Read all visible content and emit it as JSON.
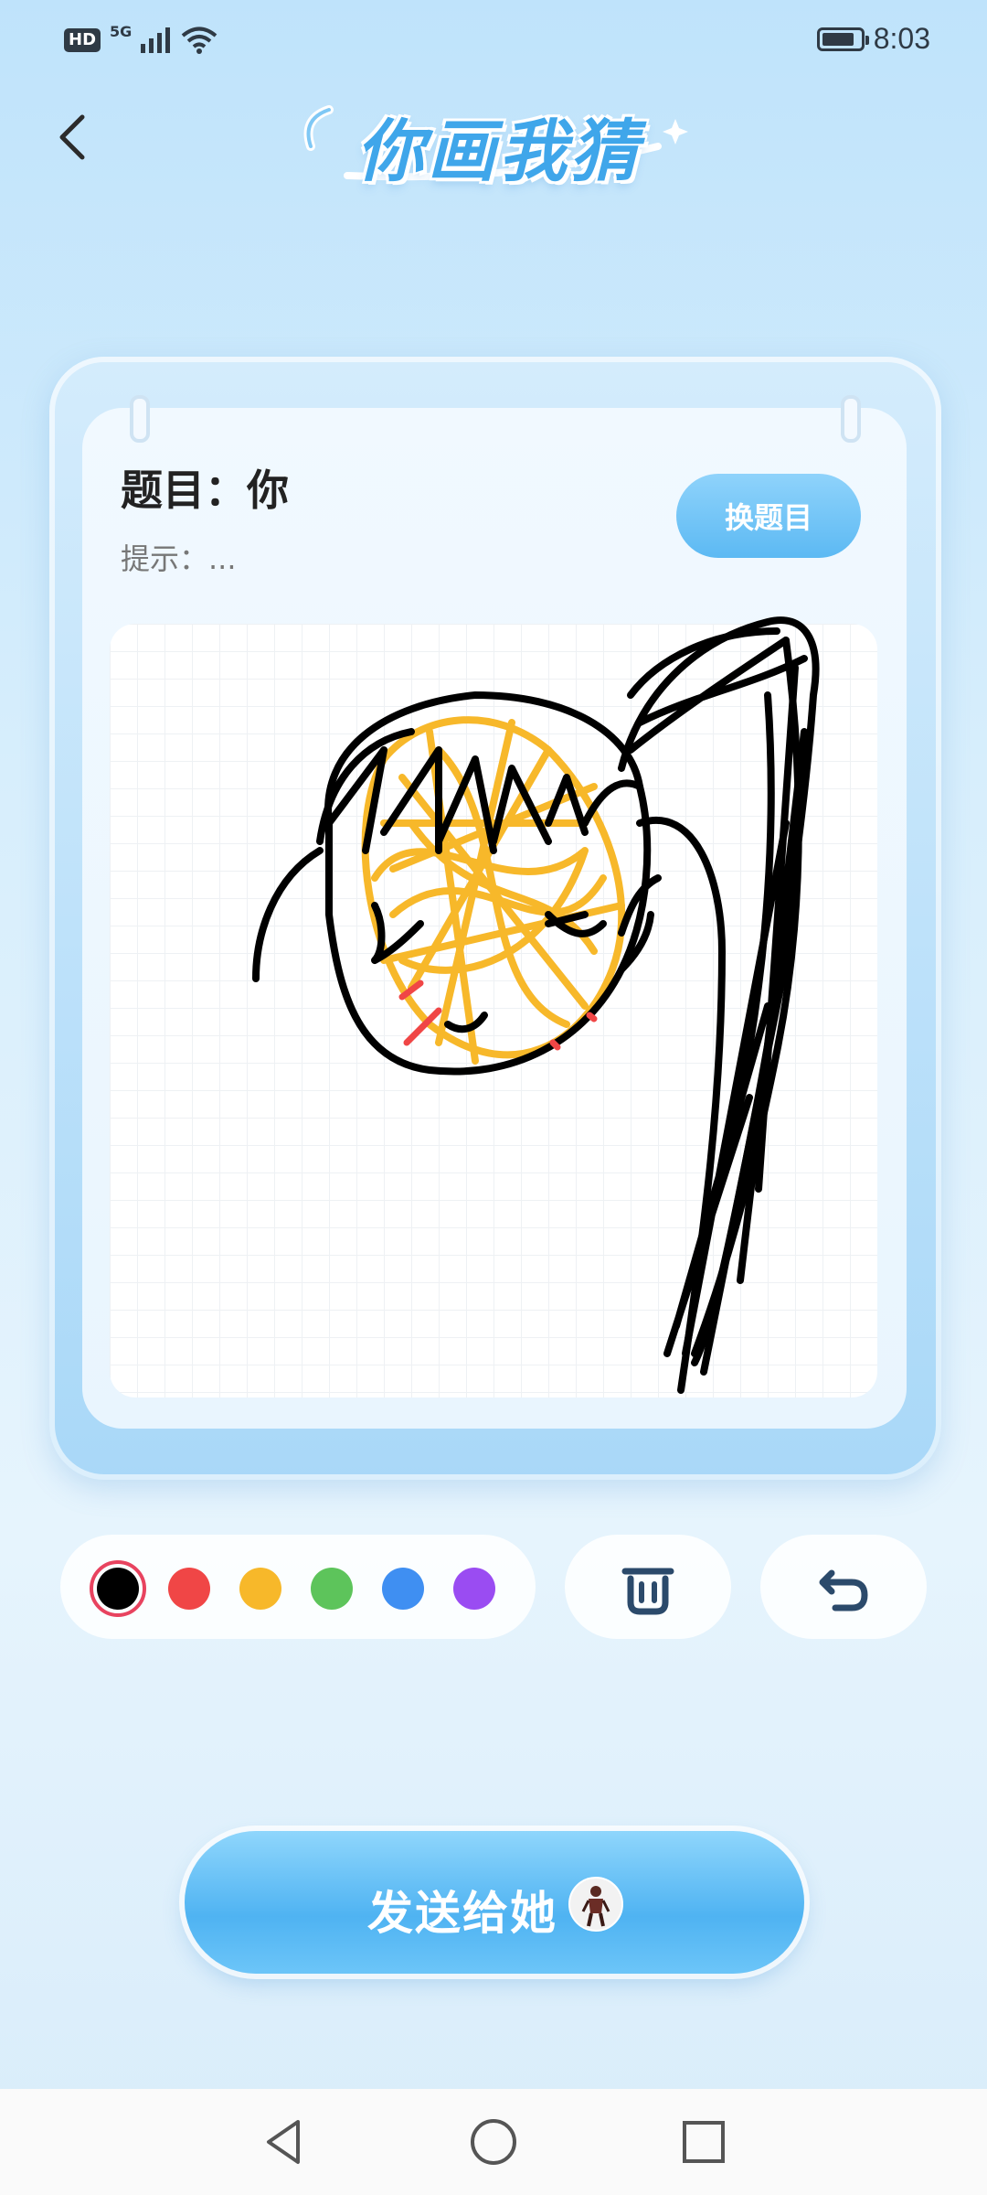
{
  "status_bar": {
    "hd": "HD",
    "network": "5G",
    "time": "8:03",
    "battery_level": 0.85
  },
  "header": {
    "title": "你画我猜"
  },
  "topic": {
    "label": "题目：你",
    "hint": "提示：..."
  },
  "buttons": {
    "change_topic": "换题目",
    "send": "发送给她"
  },
  "palette": {
    "colors": [
      "#000000",
      "#f04646",
      "#f7b82a",
      "#5dc45b",
      "#3f8ff2",
      "#9a4cf2"
    ],
    "selected": "#000000"
  },
  "icons": {
    "back": "chevron-left-icon",
    "clear": "trash-icon",
    "undo": "undo-icon",
    "nav_back": "triangle-back-icon",
    "nav_home": "circle-home-icon",
    "nav_recent": "square-recent-icon"
  }
}
